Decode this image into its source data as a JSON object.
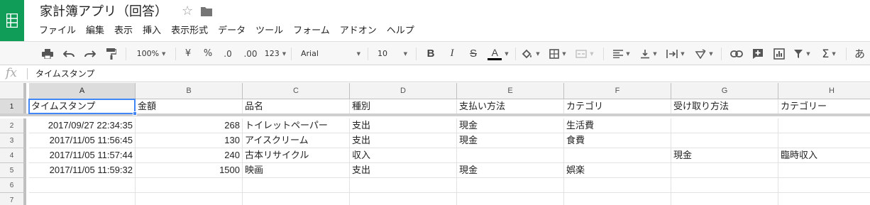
{
  "doc": {
    "title": "家計簿アプリ（回答）"
  },
  "menu": [
    "ファイル",
    "編集",
    "表示",
    "挿入",
    "表示形式",
    "データ",
    "ツール",
    "フォーム",
    "アドオン",
    "ヘルプ"
  ],
  "toolbar": {
    "zoom": "100%",
    "currency": "¥",
    "percent": "%",
    "dec_decrease": ".0",
    "dec_increase": ".00",
    "more_formats": "123",
    "font": "Arial",
    "font_size": "10",
    "bold": "B",
    "italic": "I",
    "strike": "S",
    "text_color_label": "A",
    "text_color": "#000000",
    "overflow_text": "あ"
  },
  "formula_bar": {
    "fx": "fx",
    "value": "タイムスタンプ"
  },
  "grid": {
    "columns": [
      "A",
      "B",
      "C",
      "D",
      "E",
      "F",
      "G",
      "H"
    ],
    "row_numbers": [
      "1",
      "2",
      "3",
      "4",
      "5",
      "6",
      "7"
    ],
    "rows": [
      [
        "タイムスタンプ",
        "金額",
        "品名",
        "種別",
        "支払い方法",
        "カテゴリ",
        "受け取り方法",
        "カテゴリー"
      ],
      [
        "2017/09/27 22:34:35",
        "268",
        "トイレットペーパー",
        "支出",
        "現金",
        "生活費",
        "",
        ""
      ],
      [
        "2017/11/05 11:56:45",
        "130",
        "アイスクリーム",
        "支出",
        "現金",
        "食費",
        "",
        ""
      ],
      [
        "2017/11/05 11:57:44",
        "240",
        "古本リサイクル",
        "収入",
        "",
        "",
        "現金",
        "臨時収入"
      ],
      [
        "2017/11/05 11:59:32",
        "1500",
        "映画",
        "支出",
        "現金",
        "娯楽",
        "",
        ""
      ],
      [
        "",
        "",
        "",
        "",
        "",
        "",
        "",
        ""
      ],
      [
        "",
        "",
        "",
        "",
        "",
        "",
        "",
        ""
      ]
    ],
    "numeric_columns": [
      0,
      1
    ],
    "selected_cell": "A1"
  },
  "colors": {
    "brand": "#0f9d58",
    "selection": "#4285f4"
  },
  "icons": {
    "app": "sheets-logo-icon",
    "star": "star-icon",
    "folder": "folder-icon",
    "print": "print-icon",
    "undo": "undo-icon",
    "redo": "redo-icon",
    "paint": "paint-format-icon",
    "fill": "fill-color-icon",
    "borders": "borders-icon",
    "merge": "merge-cells-icon",
    "halign": "align-horizontal-icon",
    "valign": "align-vertical-icon",
    "wrap": "text-wrap-icon",
    "rotate": "text-rotate-icon",
    "link": "link-icon",
    "comment": "comment-icon",
    "chart": "chart-icon",
    "filter": "filter-icon",
    "functions": "functions-icon"
  }
}
